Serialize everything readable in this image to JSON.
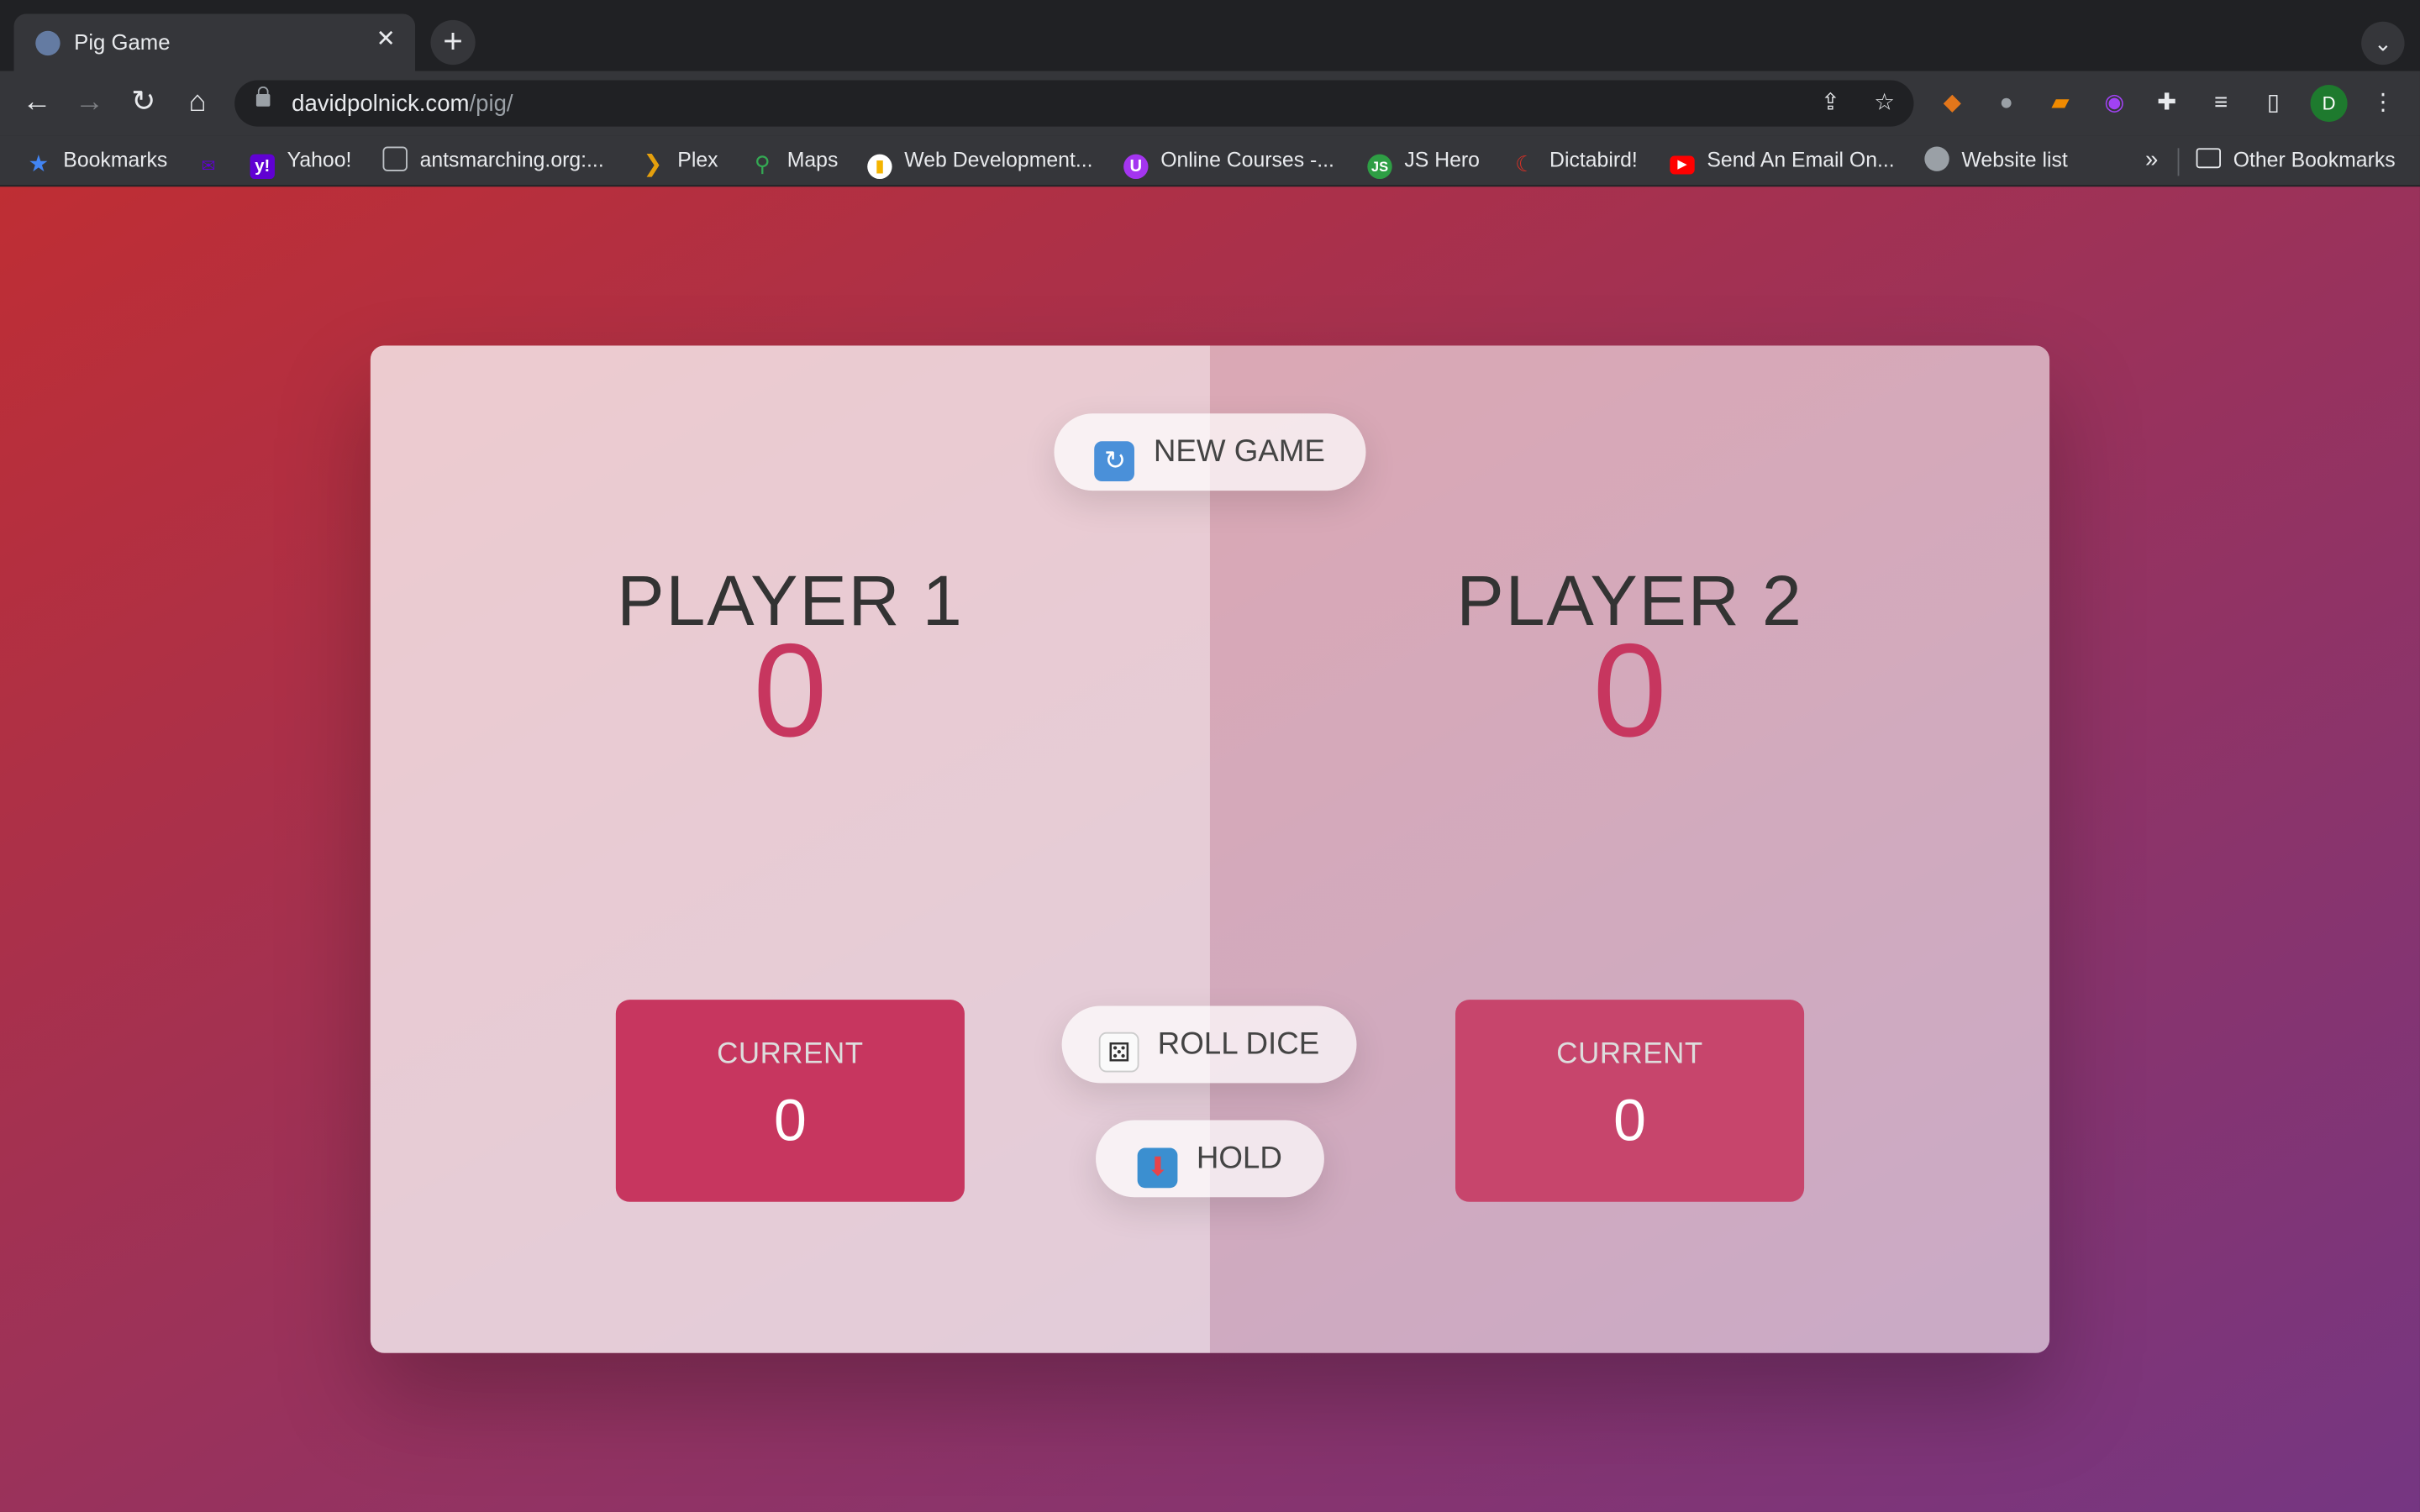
{
  "browser": {
    "tab_title": "Pig Game",
    "url_host": "davidpolnick.com",
    "url_path": "/pig/",
    "profile_initial": "D",
    "bookmarks": [
      {
        "label": "Bookmarks",
        "icon": "star-icon",
        "color": "#4285f4"
      },
      {
        "label": "",
        "icon": "yahoo-mail-icon",
        "color": "#5f01d1"
      },
      {
        "label": "Yahoo!",
        "icon": "yahoo-icon",
        "color": "#6001d2"
      },
      {
        "label": "antsmarching.org:...",
        "icon": "antsmarching-icon",
        "color": "#9aa0a6"
      },
      {
        "label": "Plex",
        "icon": "plex-icon",
        "color": "#e5a00d"
      },
      {
        "label": "Maps",
        "icon": "maps-icon",
        "color": "#34a853"
      },
      {
        "label": "Web Development...",
        "icon": "web-dev-icon",
        "color": "#f4b400"
      },
      {
        "label": "Online Courses -...",
        "icon": "online-courses-icon",
        "color": "#a435f0"
      },
      {
        "label": "JS Hero",
        "icon": "js-hero-icon",
        "color": "#2e9e44"
      },
      {
        "label": "Dictabird!",
        "icon": "dictabird-icon",
        "color": "#d93025"
      },
      {
        "label": "Send An Email On...",
        "icon": "youtube-icon",
        "color": "#ff0000"
      },
      {
        "label": "Website list",
        "icon": "globe-icon",
        "color": "#9aa0a6"
      }
    ],
    "overflow_label": "»",
    "other_bookmarks": "Other Bookmarks"
  },
  "game": {
    "new_game_label": "NEW GAME",
    "roll_dice_label": "ROLL DICE",
    "hold_label": "HOLD",
    "players": [
      {
        "name": "PLAYER 1",
        "score": "0",
        "current_label": "CURRENT",
        "current_score": "0"
      },
      {
        "name": "PLAYER 2",
        "score": "0",
        "current_label": "CURRENT",
        "current_score": "0"
      }
    ]
  },
  "colors": {
    "score": "#c7365f",
    "current_box": "#c7365f",
    "gradient_start": "#bf2e34",
    "gradient_end": "#753682"
  }
}
